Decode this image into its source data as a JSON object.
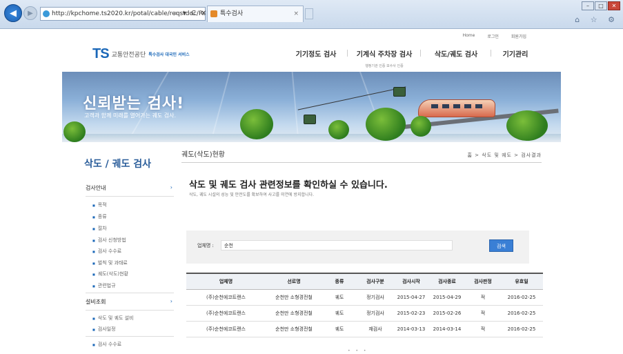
{
  "browser": {
    "url": "http://kpchome.ts2020.kr/potal/cable/reqstdoc/Re",
    "addr_controls": "⌕ ▾ C ✕",
    "tab_title": "특수검사",
    "tab_close": "×",
    "win_min": "–",
    "win_max": "□",
    "win_close": "✕",
    "right_icons": "⌂ ☆ ⚙"
  },
  "header": {
    "util_links": [
      "Home",
      "로그인",
      "회원가입"
    ],
    "logo_mark": "TS",
    "logo_org": "교통안전공단",
    "logo_service": "특수검사 대국민 서비스",
    "menus": [
      {
        "label": "기기정도 검사",
        "sub": ""
      },
      {
        "label": "기계식 주차장 검사",
        "sub": "행정기관 인증   보수사 인증"
      },
      {
        "label": "삭도/궤도 검사",
        "sub": ""
      },
      {
        "label": "기기관리",
        "sub": ""
      }
    ]
  },
  "banner": {
    "headline": "신뢰받는 검사!",
    "sub": "고객과 함께 미래를 열어가는 궤도 검사."
  },
  "sidebar": {
    "title": "삭도 / 궤도 검사",
    "cat1": "검사안내",
    "cat1_items": [
      "목적",
      "종류",
      "절차",
      "검사 신청방법",
      "검사 수수료",
      "벌칙 및 과태료",
      "궤도(삭도)현황",
      "관련법규"
    ],
    "cat2": "설비조회",
    "cat2_items": [
      "삭도 및 궤도 설비",
      "검사일정"
    ],
    "cat3_items": [
      "검사 수수료"
    ],
    "arrow": "›"
  },
  "content": {
    "title": "궤도(삭도)현황",
    "breadcrumb": "홈 > 삭도 및 궤도 > 검사결과",
    "intro_heading": "삭도 및 궤도 검사 관련정보를 확인하실 수 있습니다.",
    "intro_sub": "삭도, 궤도 시설의 성능 및 안전도를 확보하여 사고를 미연에 방지합니다.",
    "search_label": "업체명 :",
    "search_value": "순천",
    "search_button": "검색",
    "pager": "• • •"
  },
  "table": {
    "headers": [
      "업체명",
      "선로명",
      "종류",
      "검사구분",
      "검사시작",
      "검사종료",
      "검사판정",
      "유효일"
    ],
    "rows": [
      [
        "(주)순천에코트랜스",
        "순천만 소형경전철",
        "궤도",
        "정기검사",
        "2015-04-27",
        "2015-04-29",
        "적",
        "2016-02-25"
      ],
      [
        "(주)순천에코트랜스",
        "순천만 소형경전철",
        "궤도",
        "정기검사",
        "2015-02-23",
        "2015-02-26",
        "적",
        "2016-02-25"
      ],
      [
        "(주)순천에코트랜스",
        "순천만 소형경전철",
        "궤도",
        "재검사",
        "2014-03-13",
        "2014-03-14",
        "적",
        "2016-02-25"
      ]
    ]
  }
}
